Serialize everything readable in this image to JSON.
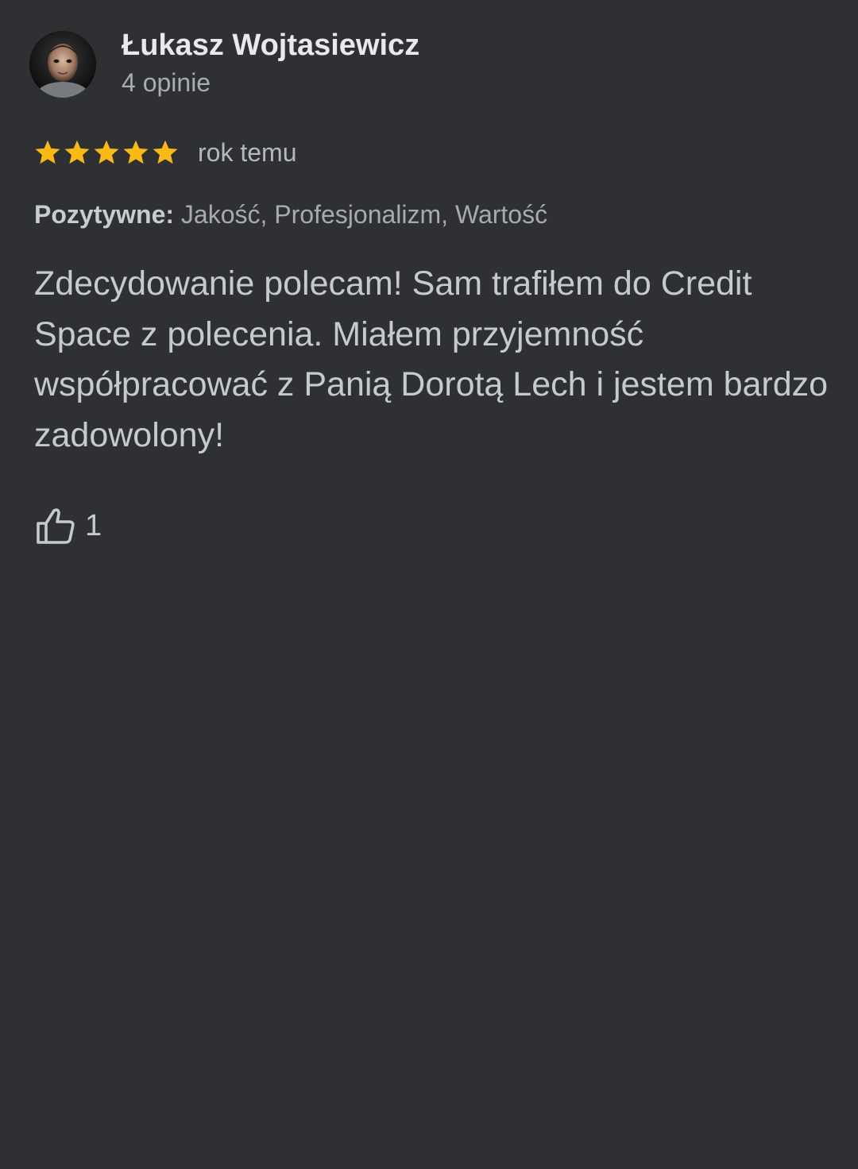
{
  "review": {
    "author": {
      "name": "Łukasz Wojtasiewicz",
      "meta": "4 opinie",
      "avatar_icon": "user-photo"
    },
    "rating": {
      "stars": 5,
      "max_stars": 5,
      "star_color": "#f9ba13"
    },
    "date": "rok temu",
    "attributes": {
      "label": "Pozytywne:",
      "values": "Jakość, Profesjonalizm, Wartość"
    },
    "text": "Zdecydowanie polecam! Sam trafiłem do Credit Space z polecenia. Miałem przyjemność współpracować z Panią Dorotą Lech i jestem bardzo zadowolony!",
    "likes": {
      "icon": "thumbs-up-icon",
      "count": "1"
    }
  },
  "colors": {
    "background": "#2f3034",
    "name_text": "#e8e9ec",
    "body_text": "#c6c9ce"
  }
}
